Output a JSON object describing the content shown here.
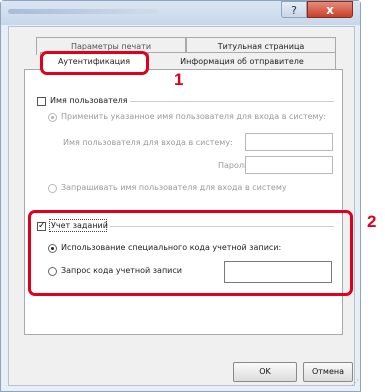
{
  "window": {
    "help_label": "?",
    "close_label": "x"
  },
  "tabs": {
    "row_top": [
      {
        "label": "Параметры печати"
      },
      {
        "label": "Титульная страница"
      }
    ],
    "row_front": [
      {
        "label": "Аутентификация"
      },
      {
        "label": "Информация об отправителе"
      }
    ]
  },
  "auth": {
    "username_label": "Имя пользователя",
    "use_login_name": "Применить указанное имя пользователя для входа в систему:",
    "login_name_field_label": "Имя пользователя для входа в систему:",
    "password_label": "Пароль:",
    "prompt_login_name": "Запрашивать имя пользователя для входа в систему"
  },
  "job_accounting": {
    "label": "Учет заданий",
    "use_specific_code": "Использование специального кода учетной записи:",
    "prompt_code": "Запрос кода учетной записи"
  },
  "buttons": {
    "ok": "OK",
    "cancel": "Отмена"
  },
  "callouts": {
    "one": "1",
    "two": "2"
  },
  "colors": {
    "highlight": "#e0001b"
  }
}
